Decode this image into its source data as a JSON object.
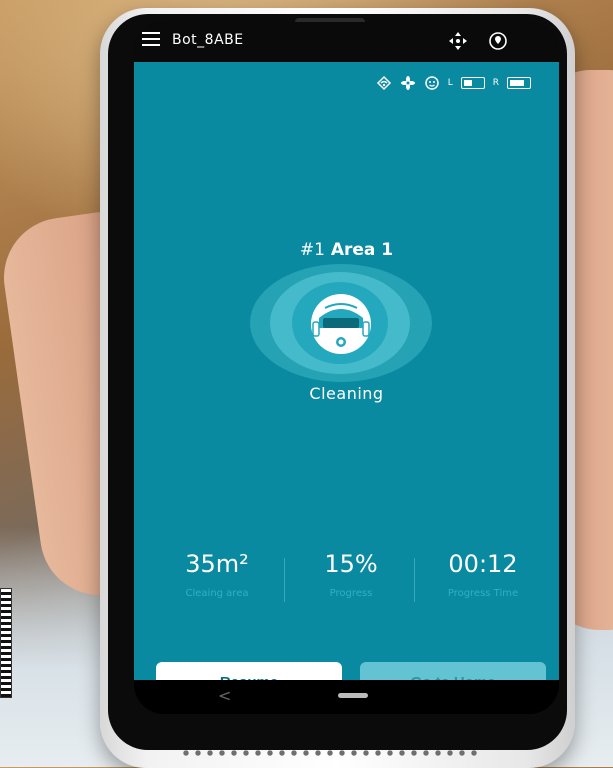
{
  "app": {
    "device_name": "Bot_8ABE",
    "icons": {
      "menu": "hamburger-menu-icon",
      "move": "remote-control-icon",
      "location": "location-pin-icon"
    }
  },
  "status_bar": {
    "icons": [
      "wifi-signal-icon",
      "fan-suction-icon",
      "robot-face-icon"
    ],
    "left_brush_label": "L",
    "right_brush_label": "R",
    "left_level": 0.5,
    "right_level": 0.85
  },
  "main": {
    "area_prefix": "#1",
    "area_name": "Area 1",
    "status": "Cleaning"
  },
  "stats": [
    {
      "value": "35m²",
      "label": "Cleaing area"
    },
    {
      "value": "15%",
      "label": "Progress"
    },
    {
      "value": "00:12",
      "label": "Progress Time"
    }
  ],
  "actions": {
    "resume": "Resume",
    "go_home": "Go to Home"
  },
  "navbar": {
    "back_glyph": "<"
  },
  "colors": {
    "app_bg": "#0a8aa0",
    "button_primary_bg": "#ffffff",
    "button_primary_text": "#0b6f80",
    "button_disabled_bg": "#63c3d2"
  }
}
